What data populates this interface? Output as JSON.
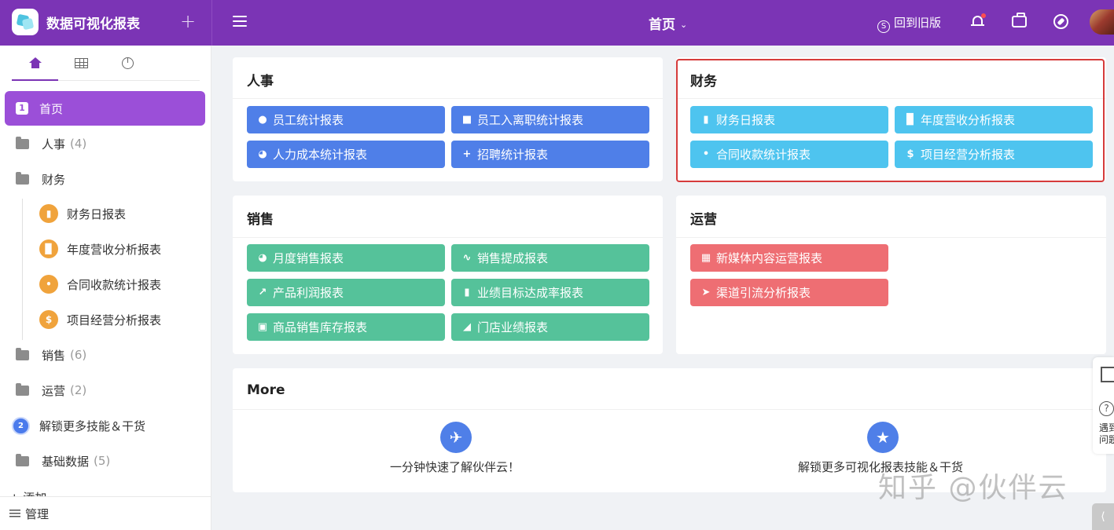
{
  "app": {
    "title": "数据可视化报表",
    "add_symbol": "+"
  },
  "header": {
    "page_title": "首页",
    "old_version": "回到旧版"
  },
  "sidebar": {
    "items": [
      {
        "label": "首页",
        "badge": "1"
      },
      {
        "label": "人事",
        "count": "(4)"
      },
      {
        "label": "财务"
      },
      {
        "label": "销售",
        "count": "(6)"
      },
      {
        "label": "运营",
        "count": "(2)"
      },
      {
        "label": "解锁更多技能＆干货",
        "badge": "2"
      },
      {
        "label": "基础数据",
        "count": "(5)"
      }
    ],
    "finance_children": [
      {
        "label": "财务日报表",
        "icon": "document-icon"
      },
      {
        "label": "年度营收分析报表",
        "icon": "bar-chart-icon"
      },
      {
        "label": "合同收款统计报表",
        "icon": "paperclip-icon"
      },
      {
        "label": "项目经营分析报表",
        "icon": "dollar-icon"
      }
    ],
    "add_label": "+ 添加",
    "manage_label": "管理"
  },
  "cards": {
    "hr": {
      "title": "人事",
      "buttons": [
        "员工统计报表",
        "员工入离职统计报表",
        "人力成本统计报表",
        "招聘统计报表"
      ]
    },
    "finance": {
      "title": "财务",
      "buttons": [
        "财务日报表",
        "年度营收分析报表",
        "合同收款统计报表",
        "项目经营分析报表"
      ]
    },
    "sales": {
      "title": "销售",
      "buttons": [
        "月度销售报表",
        "销售提成报表",
        "产品利润报表",
        "业绩目标达成率报表",
        "商品销售库存报表",
        "门店业绩报表"
      ]
    },
    "ops": {
      "title": "运营",
      "buttons": [
        "新媒体内容运营报表",
        "渠道引流分析报表"
      ]
    },
    "more": {
      "title": "More",
      "items": [
        "一分钟快速了解伙伴云！",
        "解锁更多可视化报表技能＆干货"
      ]
    }
  },
  "float_panel": {
    "help_line1": "遇到",
    "help_line2": "问题"
  },
  "watermark": "知乎 @伙伴云",
  "colors": {
    "header": "#7b34b5",
    "active_nav": "#9b4fd8",
    "blue": "#4f7fe8",
    "cyan": "#4ec4ef",
    "green": "#55c29a",
    "red": "#ee6e73",
    "highlight": "#d63b3b"
  }
}
